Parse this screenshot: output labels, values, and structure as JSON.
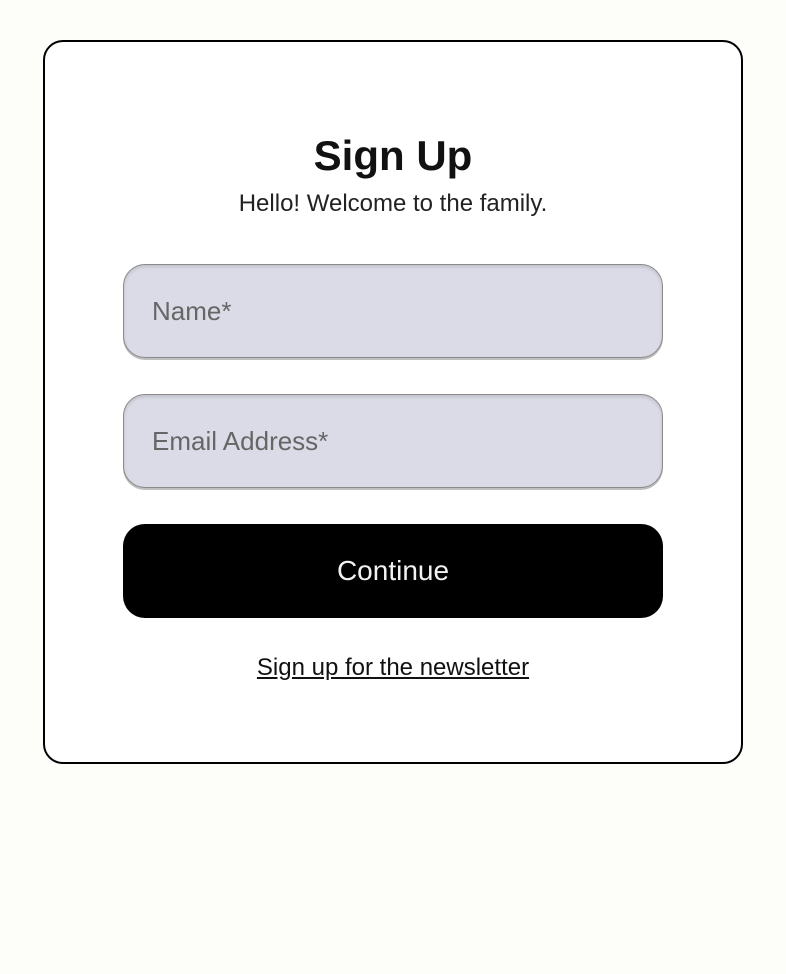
{
  "signup": {
    "title": "Sign Up",
    "subtitle": "Hello! Welcome to the family.",
    "name_placeholder": "Name*",
    "email_placeholder": "Email Address*",
    "continue_label": "Continue",
    "newsletter_label": "Sign up for the newsletter"
  }
}
